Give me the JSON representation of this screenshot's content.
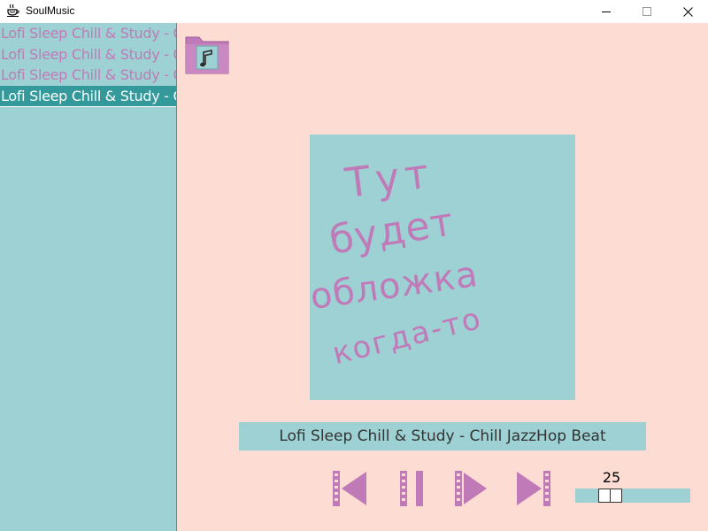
{
  "window": {
    "title": "SoulMusic"
  },
  "playlist": {
    "items": [
      {
        "label": "Lofi Sleep Chill & Study - Chill JazzHop Beat",
        "selected": false
      },
      {
        "label": "Lofi Sleep Chill & Study - Chill JazzHop Beat",
        "selected": false
      },
      {
        "label": "Lofi Sleep Chill & Study - Chill JazzHop Beat",
        "selected": false
      },
      {
        "label": "Lofi Sleep Chill & Study - Chill JazzHop Beat",
        "selected": true
      }
    ]
  },
  "cover": {
    "lines": [
      "Тут",
      "будет",
      "обложка",
      "когда-то"
    ]
  },
  "player": {
    "now_playing": "Lofi Sleep Chill & Study - Chill JazzHop Beat",
    "volume_value": "25",
    "volume": 25
  },
  "icons": {
    "app": "coffee-icon",
    "folder": "music-folder-icon",
    "prev": "previous-track-icon",
    "pause": "pause-icon",
    "play": "play-icon",
    "next": "next-track-icon"
  },
  "colors": {
    "main_bg": "#fcdcd3",
    "panel_bg": "#9ed1d3",
    "accent": "#c07ab8",
    "selected_bg": "#33999a"
  }
}
